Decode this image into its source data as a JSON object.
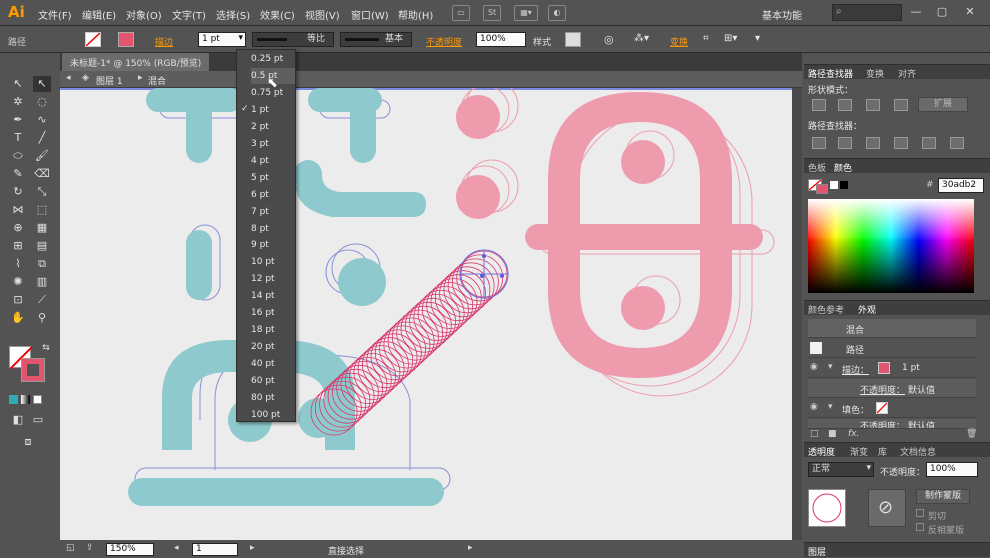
{
  "menubar": {
    "logo": "Ai",
    "items": [
      "文件(F)",
      "编辑(E)",
      "对象(O)",
      "文字(T)",
      "选择(S)",
      "效果(C)",
      "视图(V)",
      "窗口(W)",
      "帮助(H)"
    ],
    "workspace": "基本功能"
  },
  "controlbar": {
    "selection_label": "路径",
    "stroke_label": "描边",
    "stroke_weight": "1 pt",
    "profile_label": "等比",
    "brush_label": "基本",
    "opacity_label": "不透明度",
    "opacity_value": "100%",
    "style_label": "样式",
    "transform_label": "变换"
  },
  "document": {
    "tab_title": "未标题-1* @ 150% (RGB/预览)",
    "tab_title_right": "@ 150% (RGB/预览)",
    "layer_label": "图层 1",
    "group_label": "混合"
  },
  "stroke_dropdown": {
    "options": [
      "0.25 pt",
      "0.5 pt",
      "0.75 pt",
      "1 pt",
      "2 pt",
      "3 pt",
      "4 pt",
      "5 pt",
      "6 pt",
      "7 pt",
      "8 pt",
      "9 pt",
      "10 pt",
      "12 pt",
      "14 pt",
      "16 pt",
      "18 pt",
      "20 pt",
      "40 pt",
      "60 pt",
      "80 pt",
      "100 pt"
    ],
    "selected": "1 pt",
    "hovered": "0.5 pt"
  },
  "pathfinder_panel": {
    "tabs": [
      "路径查找器",
      "变换",
      "对齐"
    ],
    "shape_modes_label": "形状模式：",
    "pathfinders_label": "路径查找器：",
    "expand_label": "扩展"
  },
  "color_panel": {
    "tabs": [
      "色板",
      "颜色"
    ],
    "hex_value": "30adb2"
  },
  "appearance_panel": {
    "tabs": [
      "颜色参考",
      "外观"
    ],
    "rows": [
      {
        "label": "混合",
        "value": ""
      },
      {
        "label": "路径",
        "value": ""
      },
      {
        "label": "描边：",
        "value": "1 pt"
      },
      {
        "label": "不透明度：",
        "value": "默认值"
      },
      {
        "label": "填色：",
        "value": ""
      },
      {
        "label": "不透明度：",
        "value": "默认值"
      }
    ],
    "fx_label": "fx."
  },
  "transparency_panel": {
    "tabs": [
      "透明度",
      "渐变",
      "库",
      "文档信息"
    ],
    "blend_mode": "正常",
    "opacity_label": "不透明度：",
    "opacity_value": "100%",
    "make_mask_label": "制作蒙版",
    "clip_label": "剪切",
    "invert_label": "反相蒙版"
  },
  "layers_panel": {
    "title": "图层"
  },
  "statusbar": {
    "zoom": "150%",
    "page": "1",
    "tool_name": "直接选择"
  },
  "watermark": {
    "text": "虎课网"
  },
  "colors": {
    "teal": "#8ecacd",
    "pink": "#ee9bae",
    "outline_blue": "#8a90d6",
    "blend_magenta": "#d9356a",
    "accent_orange": "#ff9a00",
    "stroke_swatch": "#e3546e"
  }
}
